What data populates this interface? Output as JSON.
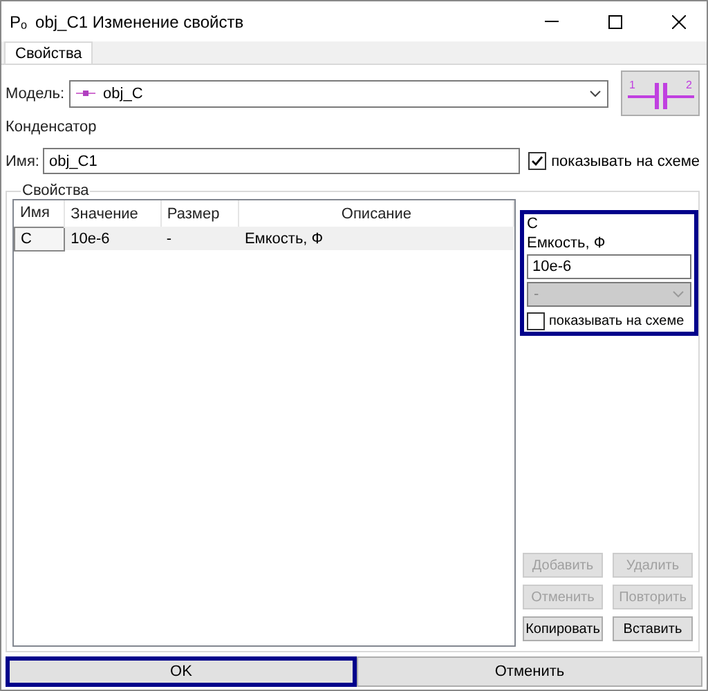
{
  "window": {
    "app_icon": "Pₒ",
    "title": "obj_C1 Изменение свойств"
  },
  "tabs": [
    {
      "label": "Свойства",
      "selected": true
    }
  ],
  "model": {
    "label": "Модель:",
    "value": "obj_C",
    "symbol_pins": [
      "1",
      "2"
    ]
  },
  "type_label": "Конденсатор",
  "name": {
    "label": "Имя:",
    "value": "obj_C1",
    "show_checkbox": {
      "label": "показывать на схеме",
      "checked": true
    }
  },
  "properties": {
    "title": "Свойства",
    "columns": [
      "Имя",
      "Значение",
      "Размер",
      "Описание"
    ],
    "rows": [
      {
        "cells": [
          "C",
          "10e-6",
          "-",
          "Емкость, Ф"
        ],
        "selected": true
      }
    ]
  },
  "editor": {
    "focused": true,
    "name": "C",
    "description": "Емкость, Ф",
    "value": "10e-6",
    "unit": {
      "value": "-",
      "disabled": true
    },
    "show_checkbox": {
      "label": "показывать на схеме",
      "checked": false
    }
  },
  "edit_buttons": [
    {
      "label": "Добавить",
      "disabled": true
    },
    {
      "label": "Удалить",
      "disabled": true
    },
    {
      "label": "Отменить",
      "disabled": true
    },
    {
      "label": "Повторить",
      "disabled": true
    },
    {
      "label": "Копировать",
      "disabled": false
    },
    {
      "label": "Вставить",
      "disabled": false
    }
  ],
  "dialog_buttons": [
    {
      "label": "OK",
      "focused": true
    },
    {
      "label": "Отменить",
      "focused": false
    }
  ]
}
